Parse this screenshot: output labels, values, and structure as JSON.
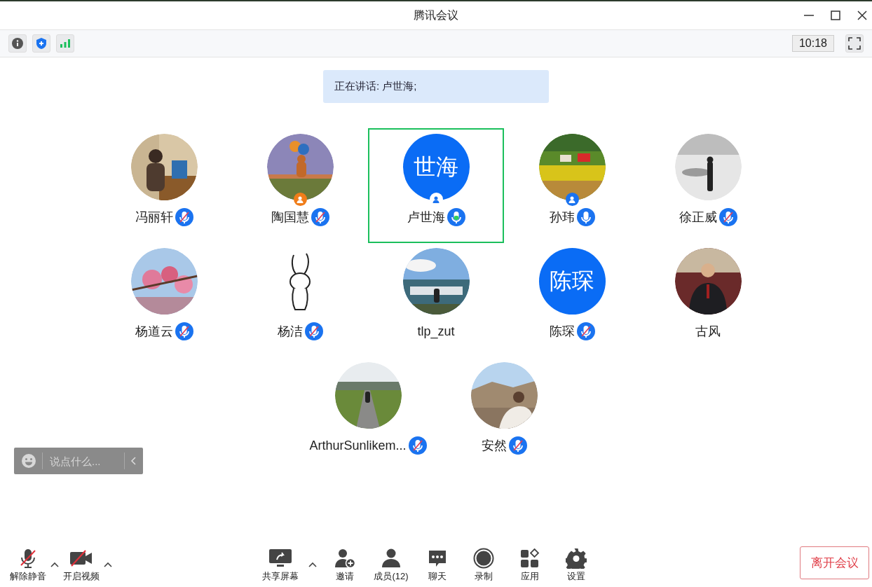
{
  "window": {
    "title": "腾讯会议"
  },
  "top_bar": {
    "time": "10:18"
  },
  "speaking_banner": "正在讲话: 卢世海;",
  "participants": [
    {
      "name": "冯丽轩",
      "has_mic": true,
      "muted": true,
      "speaking": false,
      "selected": false
    },
    {
      "name": "陶国慧",
      "has_mic": true,
      "muted": true,
      "speaking": false,
      "selected": false,
      "badge": {
        "color": "#f07d1a"
      }
    },
    {
      "name": "卢世海",
      "avatar": {
        "kind": "initials",
        "text": "世海"
      },
      "has_mic": true,
      "muted": false,
      "speaking": true,
      "selected": true,
      "badge": {
        "color": "#ffffff"
      }
    },
    {
      "name": "孙玮",
      "has_mic": true,
      "muted": false,
      "speaking": false,
      "selected": false,
      "badge": {
        "color": "#1a73f0"
      }
    },
    {
      "name": "徐正威",
      "has_mic": true,
      "muted": true,
      "speaking": false,
      "selected": false
    },
    {
      "name": "杨道云",
      "has_mic": true,
      "muted": true,
      "speaking": false,
      "selected": false
    },
    {
      "name": "杨洁",
      "has_mic": true,
      "muted": true,
      "speaking": false,
      "selected": false
    },
    {
      "name": "tlp_zut",
      "has_mic": false,
      "selected": false
    },
    {
      "name": "陈琛",
      "avatar": {
        "kind": "initials",
        "text": "陈琛"
      },
      "has_mic": true,
      "muted": true,
      "speaking": false,
      "selected": false
    },
    {
      "name": "古风",
      "has_mic": false,
      "selected": false
    },
    {
      "name": "ArthurSunlikem...",
      "has_mic": true,
      "muted": true,
      "speaking": false,
      "selected": false
    },
    {
      "name": "安然",
      "has_mic": true,
      "muted": true,
      "speaking": false,
      "selected": false
    }
  ],
  "chat_input": {
    "placeholder": "说点什么..."
  },
  "toolbar": [
    {
      "label": "解除静音",
      "kind": "mic-off",
      "has_menu": true
    },
    {
      "label": "开启视频",
      "kind": "camera-off",
      "has_menu": true
    },
    {
      "label": "共享屏幕",
      "kind": "share",
      "has_menu": true
    },
    {
      "label": "邀请",
      "kind": "invite",
      "has_menu": false
    },
    {
      "label": "成员(12)",
      "kind": "members",
      "has_menu": false
    },
    {
      "label": "聊天",
      "kind": "chat",
      "has_menu": false
    },
    {
      "label": "录制",
      "kind": "record",
      "has_menu": false
    },
    {
      "label": "应用",
      "kind": "apps",
      "has_menu": false
    },
    {
      "label": "设置",
      "kind": "settings",
      "has_menu": false
    }
  ],
  "leave_button": "离开会议"
}
